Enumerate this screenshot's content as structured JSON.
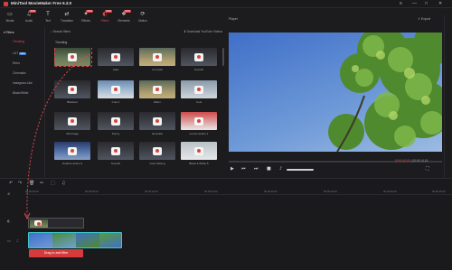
{
  "window": {
    "title": "MiniTool MovieMaker Free 6.3.0",
    "controls": [
      "≡",
      "—",
      "□",
      "✕"
    ]
  },
  "toolbar": {
    "items": [
      {
        "label": "Media",
        "icon": "folder-icon"
      },
      {
        "label": "Audio",
        "icon": "music-icon",
        "badge": "NEW"
      },
      {
        "label": "Text",
        "icon": "text-icon"
      },
      {
        "label": "Transition",
        "icon": "transition-icon"
      },
      {
        "label": "Effects",
        "icon": "effects-icon",
        "badge": "NEW"
      },
      {
        "label": "Filters",
        "icon": "filters-icon",
        "badge": "NEW"
      },
      {
        "label": "Elements",
        "icon": "elements-icon",
        "badge": "NEW"
      },
      {
        "label": "Motion",
        "icon": "motion-icon"
      }
    ],
    "active": "Filters"
  },
  "sidebar": {
    "header": "Filters",
    "items": [
      {
        "label": "Trending"
      },
      {
        "label": "LUT",
        "badge": "NEW"
      },
      {
        "label": "Retro"
      },
      {
        "label": "Cinematic"
      },
      {
        "label": "Instagram-Like"
      },
      {
        "label": "Black/White"
      }
    ],
    "active": "Trending"
  },
  "filters_panel": {
    "search_label": "Search filters",
    "download_label": "Download YouTube Videos",
    "section_title": "Trending",
    "thumbnails": [
      {
        "label": ""
      },
      {
        "label": "Lake"
      },
      {
        "label": "Ice Gold"
      },
      {
        "label": "Smooth"
      },
      {
        "label": "Blackout"
      },
      {
        "label": "Cool 1"
      },
      {
        "label": "Warm"
      },
      {
        "label": "Cool"
      },
      {
        "label": "Old Image"
      },
      {
        "label": "Sunny"
      },
      {
        "label": "Emerald"
      },
      {
        "label": "Lemon Action 1"
      },
      {
        "label": "Outdoor Action 3"
      },
      {
        "label": "Smooth"
      },
      {
        "label": "Color Meting"
      },
      {
        "label": "Black & White 5"
      }
    ]
  },
  "player": {
    "title": "Player",
    "export_label": "Export",
    "time_current": "00:00:00.00",
    "time_total": "00:00:14.15"
  },
  "timeline": {
    "ticks": [
      "00:00:00.00",
      "00:00:05.00",
      "00:00:10.00",
      "00:00:15.00",
      "00:00:20.00",
      "00:00:25.00",
      "00:00:30.00",
      "00:00:35.00"
    ]
  },
  "tooltip": {
    "text": "Drag to add filter"
  },
  "colors": {
    "accent": "#e04a4a",
    "clip_border": "#3ec8c8",
    "background": "#1c1c1f"
  }
}
